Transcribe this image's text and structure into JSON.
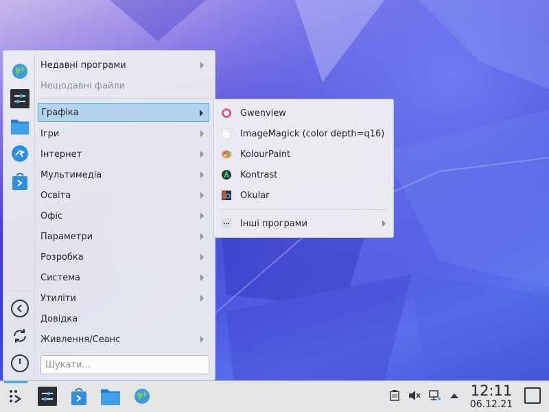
{
  "launcher": {
    "categories": [
      {
        "label": "Недавні програми"
      },
      {
        "label": "Нещодавні файли"
      },
      {
        "label": "Графіка"
      },
      {
        "label": "Ігри"
      },
      {
        "label": "Інтернет"
      },
      {
        "label": "Мультимедіа"
      },
      {
        "label": "Освіта"
      },
      {
        "label": "Офіс"
      },
      {
        "label": "Параметри"
      },
      {
        "label": "Розробка"
      },
      {
        "label": "Система"
      },
      {
        "label": "Утиліти"
      },
      {
        "label": "Довідка"
      },
      {
        "label": "Живлення/Сеанс"
      }
    ],
    "search_placeholder": "Шукати...",
    "favorites": [
      "globe-icon",
      "settings-icon",
      "folder-icon",
      "kde-connect-icon",
      "discover-icon"
    ],
    "system_actions": [
      "back-icon",
      "restart-icon",
      "shutdown-icon"
    ]
  },
  "submenu": {
    "items": [
      {
        "label": "Gwenview",
        "icon": "gwenview-icon"
      },
      {
        "label": "ImageMagick (color depth=q16)",
        "icon": "imagemagick-icon"
      },
      {
        "label": "KolourPaint",
        "icon": "kolourpaint-icon"
      },
      {
        "label": "Kontrast",
        "icon": "kontrast-icon"
      },
      {
        "label": "Okular",
        "icon": "okular-icon"
      }
    ],
    "more_label": "Інші програми"
  },
  "taskbar": {
    "apps": [
      "launcher-icon",
      "settings-icon",
      "discover-icon",
      "folder-icon",
      "globe-icon"
    ],
    "tray": [
      "clipboard-icon",
      "volume-muted-icon",
      "network-icon",
      "expand-tray-icon"
    ],
    "time": "12:11",
    "date": "06.12.21"
  },
  "colors": {
    "accent": "#3daee9",
    "selection": "#b6d3ee",
    "panel": "#e3e5e7"
  }
}
